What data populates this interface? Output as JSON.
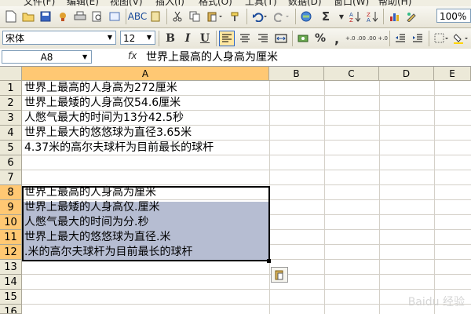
{
  "menu": [
    "文件(F)",
    "编辑(E)",
    "视图(V)",
    "插入(I)",
    "格式(O)",
    "工具(T)",
    "数据(D)",
    "窗口(W)",
    "帮助(H)"
  ],
  "toolbar": {
    "zoom": "100%",
    "sigma": "Σ"
  },
  "format_bar": {
    "font": "宋体",
    "size": "12",
    "bold": "B",
    "italic": "I",
    "underline": "U",
    "percent": "%",
    "comma": ",",
    "inc_decimal": "+.0 .00",
    "dec_decimal": ".00 +.0"
  },
  "formula_bar": {
    "name_box": "A8",
    "fx": "fx",
    "formula": "世界上最高的人身高为厘米"
  },
  "columns": [
    "A",
    "B",
    "C",
    "D",
    "E"
  ],
  "rows": [
    "1",
    "2",
    "3",
    "4",
    "5",
    "6",
    "7",
    "8",
    "9",
    "10",
    "11",
    "12",
    "13",
    "14",
    "15",
    "16"
  ],
  "cells": {
    "A1": "世界上最高的人身高为272厘米",
    "A2": "世界上最矮的人身高仅54.6厘米",
    "A3": "人憋气最大的时间为13分42.5秒",
    "A4": "世界上最大的悠悠球为直径3.65米",
    "A5": "4.37米的高尔夫球杆为目前最长的球杆",
    "A8": "世界上最高的人身高为厘米",
    "A9": "世界上最矮的人身高仅.厘米",
    "A10": "人憋气最大的时间为分.秒",
    "A11": "世界上最大的悠悠球为直径.米",
    "A12": ".米的高尔夫球杆为目前最长的球杆"
  },
  "watermark": "Baidu 经验"
}
